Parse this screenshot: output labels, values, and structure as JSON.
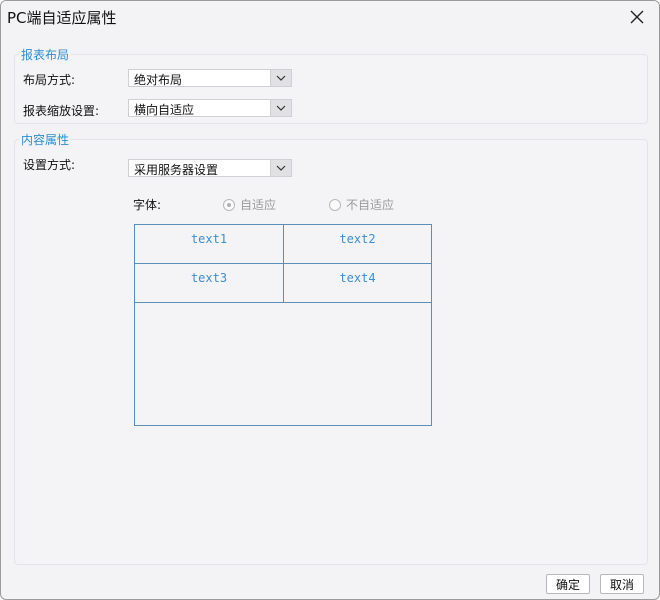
{
  "window": {
    "title": "PC端自适应属性"
  },
  "report_layout": {
    "group_title": "报表布局",
    "layout_mode_label": "布局方式:",
    "layout_mode_value": "绝对布局",
    "zoom_label": "报表缩放设置:",
    "zoom_value": "横向自适应"
  },
  "content_props": {
    "group_title": "内容属性",
    "setting_label": "设置方式:",
    "setting_value": "采用服务器设置",
    "font_label": "字体:",
    "radio_adaptive": "自适应",
    "radio_not_adaptive": "不自适应",
    "selected_radio": "自适应",
    "preview_cells": [
      "text1",
      "text2",
      "text3",
      "text4"
    ]
  },
  "footer": {
    "ok_label": "确定",
    "cancel_label": "取消"
  },
  "colors": {
    "accent": "#2a8fd0",
    "preview_border": "#5b8fb8"
  }
}
